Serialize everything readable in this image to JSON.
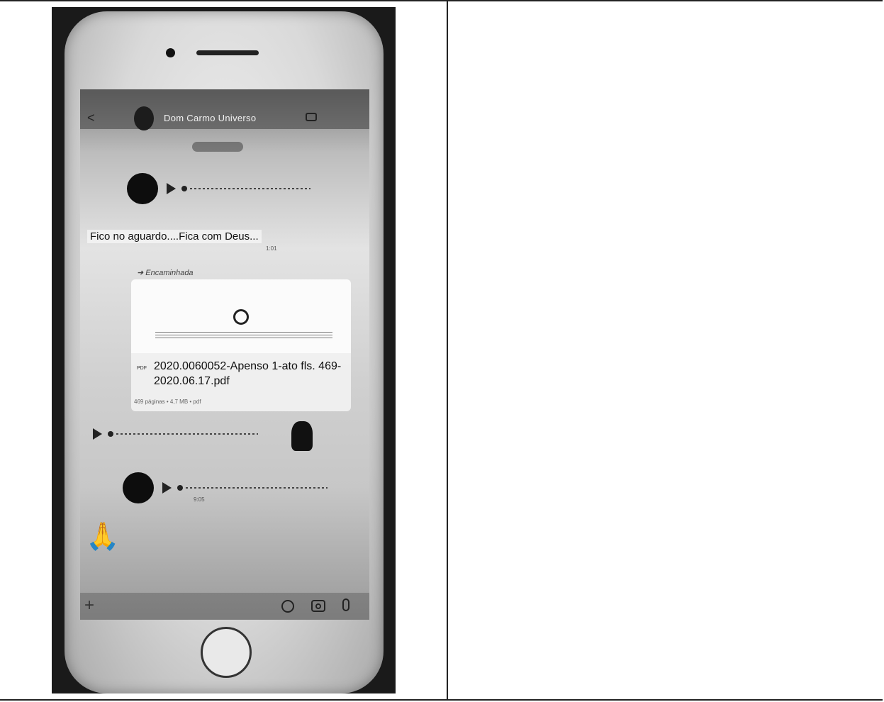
{
  "chat": {
    "contact_name": "Dom Carmo Universo",
    "messages": {
      "text_message": "Fico no aguardo....Fica com Deus...",
      "text_time": "1:01",
      "forwarded_label": "Encaminhada",
      "document": {
        "file_name": "2020.0060052-Apenso 1-ato fls. 469-2020.06.17.pdf",
        "type_label": "PDF",
        "meta": "469 páginas • 4,7 MB • pdf"
      },
      "voice_time": "9:05"
    },
    "emoji": "🙏"
  },
  "icons": [
    "back-icon",
    "video-icon",
    "play-icon",
    "plus-icon",
    "sticker-icon",
    "camera-icon",
    "mic-icon",
    "home-button",
    "emblem-icon",
    "pdf-icon"
  ]
}
